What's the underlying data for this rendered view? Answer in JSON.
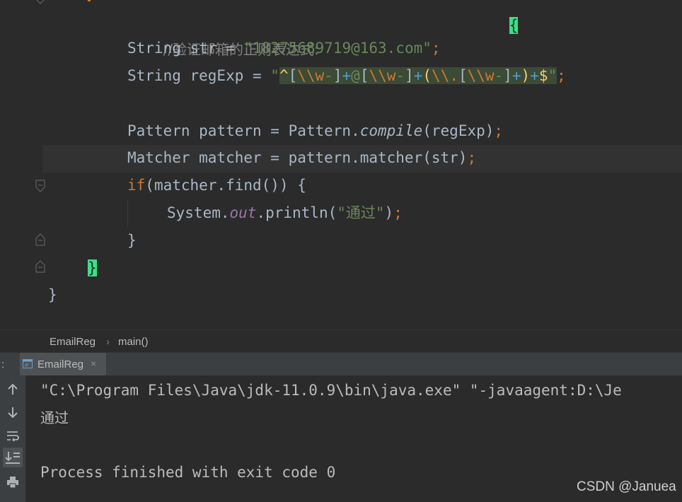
{
  "editor": {
    "comment": "//验证邮箱的正则表达式:",
    "line2": {
      "type": "String",
      "var": " str = ",
      "str": "\"18275689719@163.com\"",
      "semi": ";"
    },
    "line3": {
      "type": "String",
      "var": " regExp = ",
      "q1": "\"",
      "p1": "^",
      "p2": "[",
      "p3": "\\\\w",
      "p4": "-",
      "p5": "]",
      "p6": "+",
      "p7": "@",
      "p8": "[",
      "p9": "\\\\w",
      "p10": "-",
      "p11": "]",
      "p12": "+",
      "p13": "(",
      "p14": "\\\\.",
      "p15": "[",
      "p16": "\\\\w",
      "p17": "-",
      "p18": "]",
      "p19": "+",
      "p20": ")",
      "p21": "+",
      "p22": "$",
      "q2": "\"",
      "semi": ";"
    },
    "line5": {
      "a": "Pattern pattern = Pattern.",
      "method": "compile",
      "b": "(regExp)",
      "semi": ";"
    },
    "line6": {
      "a": "Matcher matcher = pattern.matcher(str)",
      "semi": ";"
    },
    "line7": {
      "kw": "if",
      "rest": "(matcher.find()) {"
    },
    "line8": {
      "a": "System.",
      "field": "out",
      "b": ".println(",
      "str": "\"通过\"",
      "c": ")",
      "semi": ";"
    },
    "line9": "}",
    "line10": "}",
    "line11": "}",
    "top_brace": "{"
  },
  "breadcrumb": {
    "class": "EmailReg",
    "sep": "›",
    "method": "main()"
  },
  "run": {
    "left_label": ":",
    "tab_label": "EmailReg",
    "close": "×"
  },
  "console": {
    "cmd": "\"C:\\Program Files\\Java\\jdk-11.0.9\\bin\\java.exe\" \"-javaagent:D:\\Je",
    "out": "通过",
    "exit": "Process finished with exit code 0"
  },
  "watermark": "CSDN @Januea",
  "colors": {
    "editor_bg": "#2b2b2b",
    "keyword": "#cc7832",
    "string": "#6a8759",
    "brace_match": "#3be089",
    "field": "#9876aa"
  }
}
